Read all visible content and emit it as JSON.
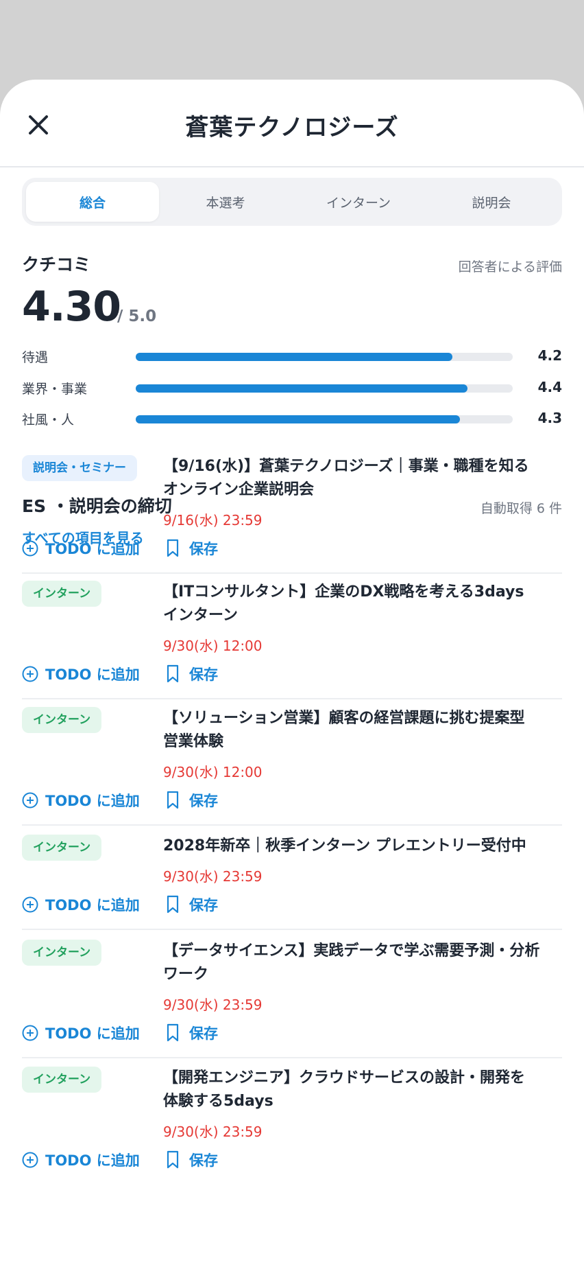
{
  "header": {
    "title": "蒼葉テクノロジーズ"
  },
  "tabs": [
    {
      "label": "総合",
      "active": true
    },
    {
      "label": "本選考",
      "active": false
    },
    {
      "label": "インターン",
      "active": false
    },
    {
      "label": "説明会",
      "active": false
    }
  ],
  "reviews": {
    "title": "クチコミ",
    "note": "回答者による評価",
    "score": "4.30",
    "score_max": "/ 5.0",
    "items": [
      {
        "label": "待遇",
        "value": "4.2"
      },
      {
        "label": "業界・事業",
        "value": "4.4"
      },
      {
        "label": "社風・人",
        "value": "4.3"
      }
    ],
    "see_all": "すべての項目を見る"
  },
  "deadlines": {
    "title": "ES ・説明会の締切",
    "note": "自動取得 6 件",
    "todo_label": "TODO に追加",
    "save_label": "保存",
    "events": [
      {
        "tag": "説明会・セミナー",
        "tag_type": "seminar",
        "title_lines": [
          "【9/16(水)】蒼葉テクノロジーズ｜事業・職種を知る",
          "オンライン企業説明会"
        ],
        "date": "9/16(水) 23:59"
      },
      {
        "tag": "インターン",
        "tag_type": "intern",
        "title_lines": [
          "【ITコンサルタント】企業のDX戦略を考える3days",
          "インターン"
        ],
        "date": "9/30(水) 12:00"
      },
      {
        "tag": "インターン",
        "tag_type": "intern",
        "title_lines": [
          "【ソリューション営業】顧客の経営課題に挑む提案型",
          "営業体験"
        ],
        "date": "9/30(水) 12:00"
      },
      {
        "tag": "インターン",
        "tag_type": "intern",
        "title_lines": [
          "2028年新卒｜秋季インターン プレエントリー受付中"
        ],
        "date": "9/30(水) 23:59"
      },
      {
        "tag": "インターン",
        "tag_type": "intern",
        "title_lines": [
          "【データサイエンス】実践データで学ぶ需要予測・分析",
          "ワーク"
        ],
        "date": "9/30(水) 23:59"
      },
      {
        "tag": "インターン",
        "tag_type": "intern",
        "title_lines": [
          "【開発エンジニア】クラウドサービスの設計・開発を",
          "体験する5days"
        ],
        "date": "9/30(水) 23:59"
      }
    ]
  },
  "colors": {
    "accent": "#1a86d6",
    "deadline": "#e53935",
    "intern_tag": "#22a15e",
    "seminar_tag": "#1a86d6"
  }
}
